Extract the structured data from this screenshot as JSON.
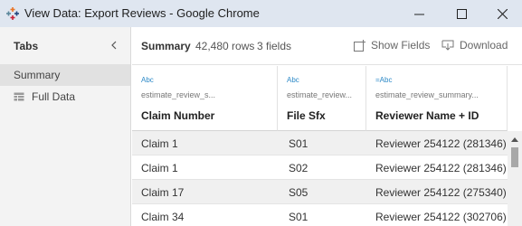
{
  "window": {
    "title": "View Data: Export Reviews - Google Chrome"
  },
  "sidebar": {
    "title": "Tabs",
    "items": [
      {
        "label": "Summary"
      },
      {
        "label": "Full Data"
      }
    ]
  },
  "main": {
    "summary_label": "Summary",
    "rows_count": "42,480 rows",
    "fields_count": "3 fields",
    "show_fields_label": "Show Fields",
    "download_label": "Download"
  },
  "table": {
    "columns": [
      {
        "type": "Abc",
        "source": "estimate_review_s...",
        "name": "Claim Number"
      },
      {
        "type": "Abc",
        "source": "estimate_review...",
        "name": "File Sfx"
      },
      {
        "type": "=Abc",
        "source": "estimate_review_summary...",
        "name": "Reviewer Name + ID"
      }
    ],
    "rows": [
      [
        "Claim 1",
        "S01",
        "Reviewer 254122 (281346)"
      ],
      [
        "Claim 1",
        "S02",
        "Reviewer 254122 (281346)"
      ],
      [
        "Claim 17",
        "S05",
        "Reviewer 254122 (275340)"
      ],
      [
        "Claim 34",
        "S01",
        "Reviewer 254122 (302706)"
      ]
    ]
  },
  "colors": {
    "titlebar": "#dfe6f0",
    "sidebar_bg": "#f3f3f3",
    "type_label": "#2c89c7",
    "alt_row": "#f0f0f0"
  }
}
